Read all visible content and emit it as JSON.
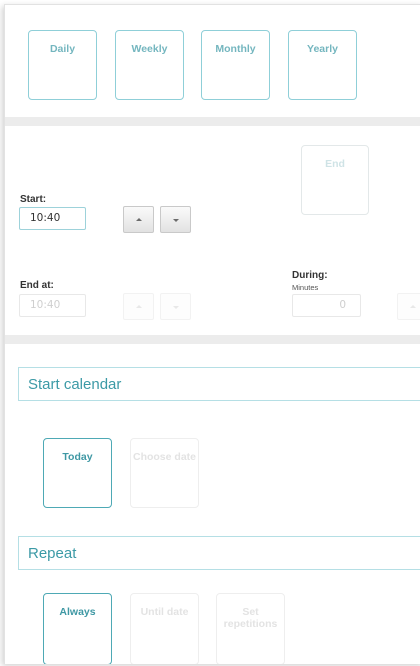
{
  "frequency": {
    "options": [
      {
        "label": "Daily"
      },
      {
        "label": "Weekly"
      },
      {
        "label": "Monthly"
      },
      {
        "label": "Yearly"
      }
    ]
  },
  "time": {
    "end_tile_label": "End",
    "start_label": "Start:",
    "start_value": "10:40",
    "end_at_label": "End at:",
    "end_at_value": "10:40",
    "during_label": "During:",
    "during_unit": "Minutes",
    "during_value": "0"
  },
  "start_calendar": {
    "title": "Start calendar",
    "options": [
      {
        "label": "Today",
        "state": "selected"
      },
      {
        "label": "Choose date",
        "state": "disabled"
      }
    ]
  },
  "repeat": {
    "title": "Repeat",
    "options": [
      {
        "label": "Always",
        "state": "selected"
      },
      {
        "label": "Until date",
        "state": "disabled"
      },
      {
        "label": "Set repetitions",
        "state": "disabled"
      }
    ]
  }
}
